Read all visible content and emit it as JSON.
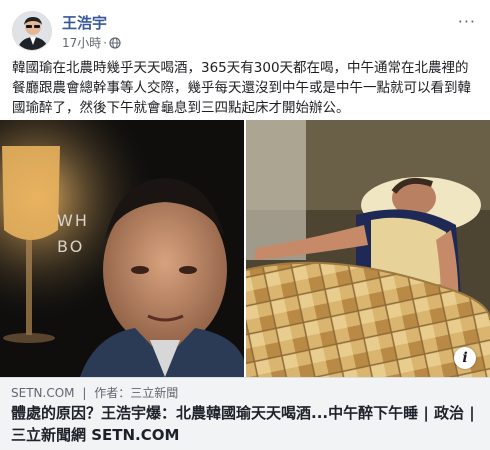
{
  "post": {
    "author": "王浩宇",
    "time": "17小時",
    "separator": "·",
    "more_label": "···",
    "text": "韓國瑜在北農時幾乎天天喝酒，365天有300天都在喝，中午通常在北農裡的餐廳跟農會總幹事等人交際，幾乎每天還沒到中午或是中午一點就可以看到韓國瑜醉了，然後下午就會龜息到三四點起床才開始辦公。"
  },
  "images": {
    "left_sign_text": [
      "WH",
      "BO"
    ],
    "info_label": "i"
  },
  "link": {
    "domain": "SETN.COM",
    "divider": "|",
    "author_label": "作者：三立新聞",
    "title": "體處的原因？王浩宇爆：北農韓國瑜天天喝酒...中午醉下午睡 | 政治 | 三立新聞網 SETN.COM"
  },
  "icons": {
    "avatar": "avatar-photo",
    "globe": "globe-icon",
    "more": "more-options-icon",
    "info": "info-icon"
  },
  "colors": {
    "author_link": "#385898",
    "meta_text": "#616770",
    "link_bg": "#f2f3f5"
  }
}
